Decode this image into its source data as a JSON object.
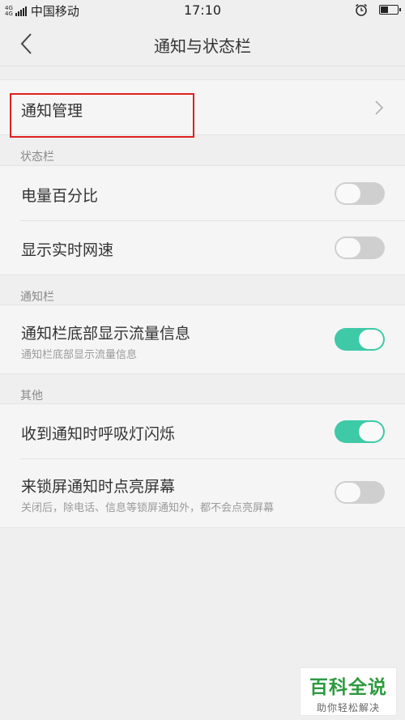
{
  "status_bar": {
    "network_top": "4G",
    "network_bottom": "4G",
    "carrier": "中国移动",
    "time": "17:10",
    "icons": [
      "signal-icon",
      "alarm-icon",
      "battery-icon"
    ]
  },
  "nav": {
    "title": "通知与状态栏",
    "back_icon": "chevron-left-icon"
  },
  "notification_management": {
    "label": "通知管理",
    "icon": "chevron-right-icon"
  },
  "sections": [
    {
      "label": "状态栏",
      "items": [
        {
          "title": "电量百分比",
          "toggle_on": false
        },
        {
          "title": "显示实时网速",
          "toggle_on": false
        }
      ]
    },
    {
      "label": "通知栏",
      "items": [
        {
          "title": "通知栏底部显示流量信息",
          "subtitle": "通知栏底部显示流量信息",
          "toggle_on": true
        }
      ]
    },
    {
      "label": "其他",
      "items": [
        {
          "title": "收到通知时呼吸灯闪烁",
          "toggle_on": true
        },
        {
          "title": "来锁屏通知时点亮屏幕",
          "subtitle": "关闭后，除电话、信息等锁屏通知外，都不会点亮屏幕",
          "toggle_on": false
        }
      ]
    }
  ],
  "colors": {
    "toggle_on": "#3ec9a7",
    "toggle_off": "#cfcfcf",
    "highlight": "#e02020",
    "background": "#efefef"
  },
  "watermark": {
    "main": "百科全说",
    "sub": "助你轻松解决"
  }
}
